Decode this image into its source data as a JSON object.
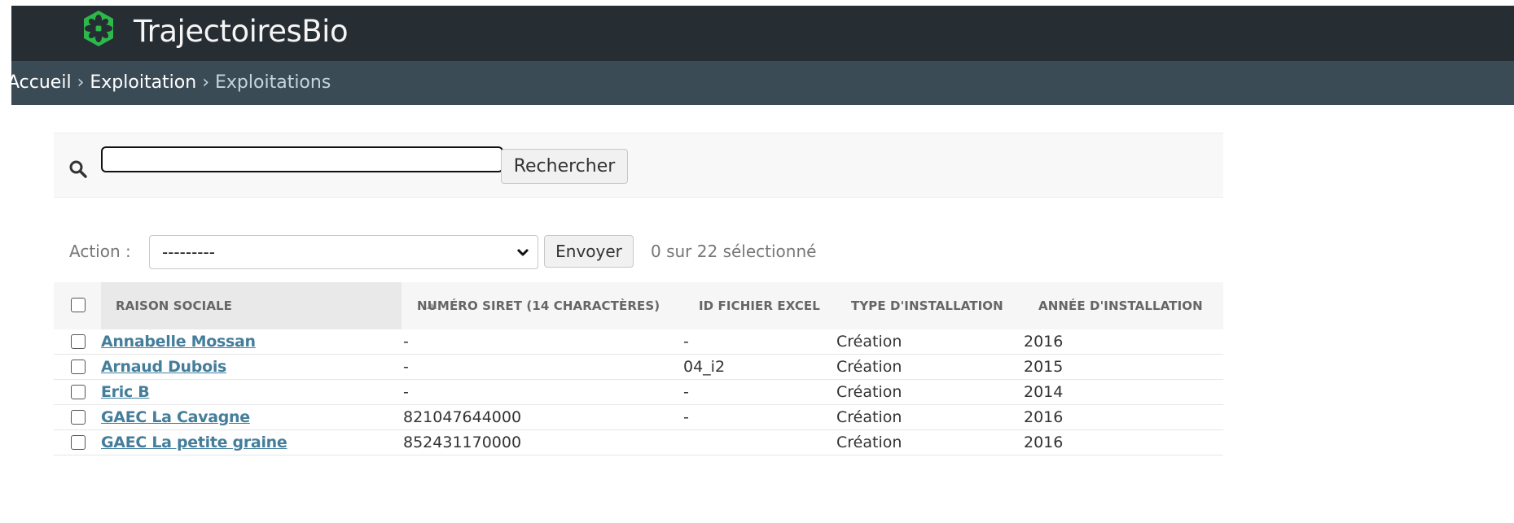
{
  "header": {
    "brand": "TrajectoiresBio",
    "logo_icon": "leaf-logo-icon",
    "colors": {
      "background": "#262d33",
      "logo": "#2db84b"
    }
  },
  "breadcrumbs": {
    "home": "Accueil",
    "separator": "›",
    "section": "Exploitation",
    "current": "Exploitations",
    "background": "#3b4b56"
  },
  "search": {
    "icon": "search-icon",
    "value": "",
    "button_label": "Rechercher"
  },
  "actions": {
    "label": "Action :",
    "selected_option": "---------",
    "submit_label": "Envoyer",
    "selection_counter": "0 sur 22 sélectionné"
  },
  "table": {
    "columns": [
      "RAISON SOCIALE",
      "NUMÉRO SIRET (14 CHARACTÈRES)",
      "ID FICHIER EXCEL",
      "TYPE D'INSTALLATION",
      "ANNÉE D'INSTALLATION"
    ],
    "sorted_column": "RAISON SOCIALE",
    "sort_direction": "ascending",
    "link_color": "#447e9b",
    "rows": [
      {
        "raison_sociale": "Annabelle Mossan",
        "siret": "-",
        "id_excel": "-",
        "type": "Création",
        "annee": "2016"
      },
      {
        "raison_sociale": "Arnaud Dubois",
        "siret": "-",
        "id_excel": "04_i2",
        "type": "Création",
        "annee": "2015"
      },
      {
        "raison_sociale": "Eric B",
        "siret": "-",
        "id_excel": "-",
        "type": "Création",
        "annee": "2014"
      },
      {
        "raison_sociale": "GAEC La Cavagne",
        "siret": "821047644000",
        "id_excel": "-",
        "type": "Création",
        "annee": "2016"
      },
      {
        "raison_sociale": "GAEC La petite graine",
        "siret": "852431170000",
        "id_excel": "",
        "type": "Création",
        "annee": "2016"
      }
    ]
  }
}
